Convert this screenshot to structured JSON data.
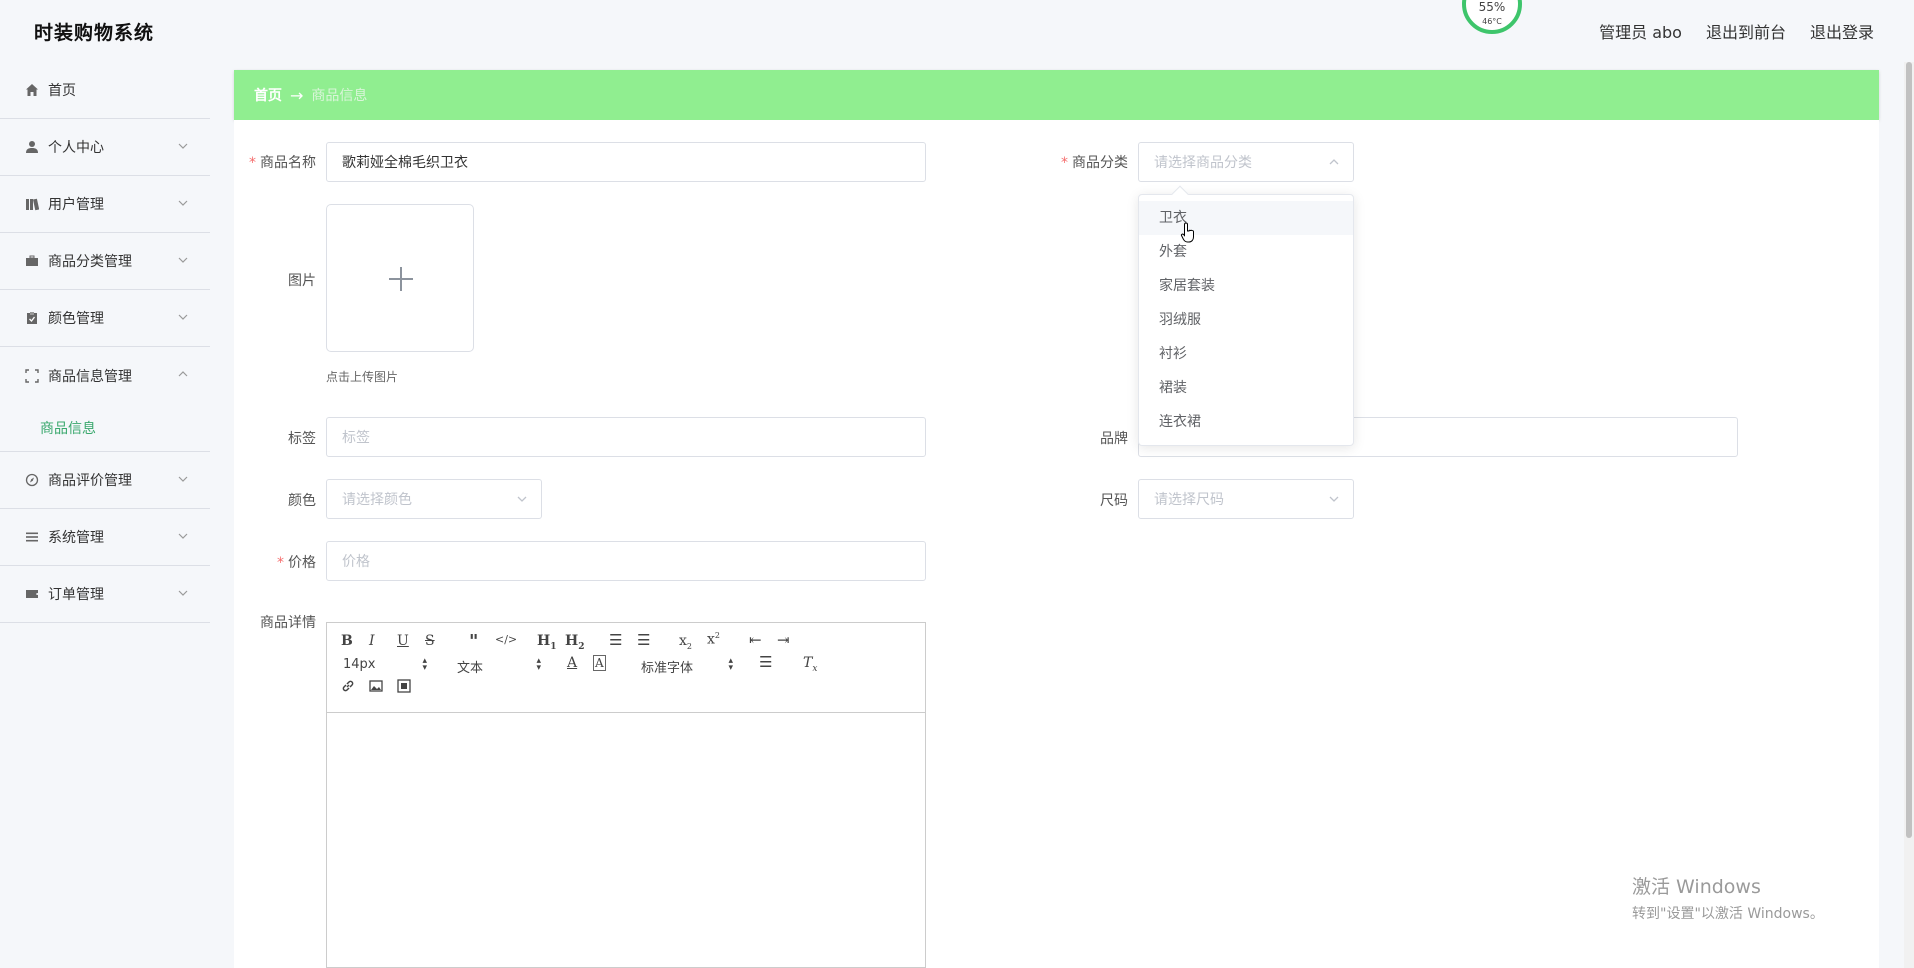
{
  "app": {
    "title": "时装购物系统",
    "cpu_percent": "55%",
    "cpu_temp": "46°C"
  },
  "header": {
    "user": "管理员 abo",
    "front_link": "退出到前台",
    "logout_link": "退出登录"
  },
  "sidebar": {
    "items": [
      {
        "label": "首页",
        "icon": "home-icon"
      },
      {
        "label": "个人中心",
        "icon": "user-icon"
      },
      {
        "label": "用户管理",
        "icon": "users-icon"
      },
      {
        "label": "商品分类管理",
        "icon": "briefcase-icon"
      },
      {
        "label": "颜色管理",
        "icon": "clipboard-icon"
      },
      {
        "label": "商品信息管理",
        "icon": "frame-icon",
        "sub": "商品信息"
      },
      {
        "label": "商品评价管理",
        "icon": "compass-icon"
      },
      {
        "label": "系统管理",
        "icon": "list-icon"
      },
      {
        "label": "订单管理",
        "icon": "ticket-icon"
      }
    ]
  },
  "breadcrumb": {
    "home": "首页",
    "separator": "→",
    "current": "商品信息"
  },
  "form": {
    "name_label": "商品名称",
    "name_value": "歌莉娅全棉毛织卫衣",
    "category_label": "商品分类",
    "category_placeholder": "请选择商品分类",
    "image_label": "图片",
    "upload_tip": "点击上传图片",
    "tag_label": "标签",
    "tag_placeholder": "标签",
    "brand_label": "品牌",
    "color_label": "颜色",
    "color_placeholder": "请选择颜色",
    "size_label": "尺码",
    "size_placeholder": "请选择尺码",
    "price_label": "价格",
    "price_placeholder": "价格",
    "detail_label": "商品详情",
    "required_mark": "*"
  },
  "editor": {
    "font_size": "14px",
    "header_select": "文本",
    "font_family": "标准字体"
  },
  "category_dropdown": {
    "options": [
      "卫衣",
      "外套",
      "家居套装",
      "羽绒服",
      "衬衫",
      "裙装",
      "连衣裙"
    ],
    "hovered": "卫衣"
  },
  "watermark": {
    "line1": "激活 Windows",
    "line2": "转到\"设置\"以激活 Windows。"
  },
  "colors": {
    "accent_green": "#90ee90",
    "active_menu_text": "#3aa86d",
    "required_red": "#f56c6c"
  }
}
